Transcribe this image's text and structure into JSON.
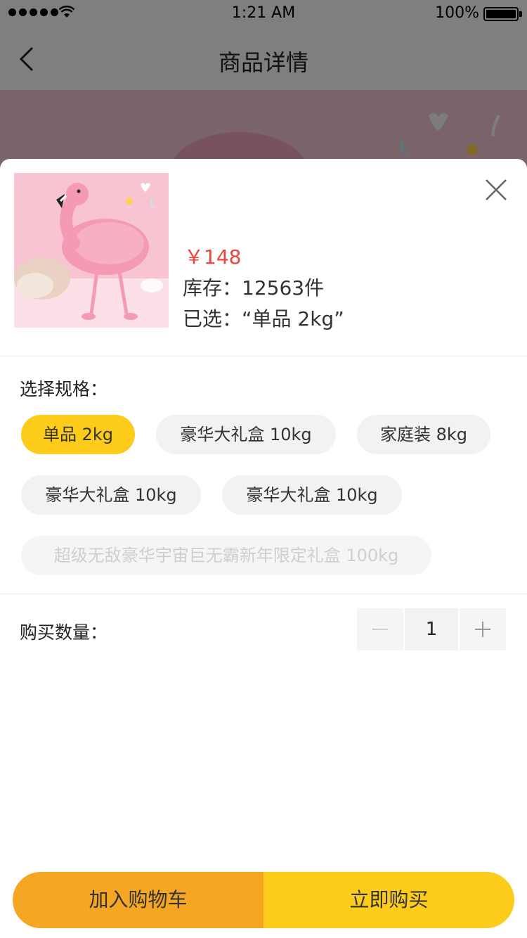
{
  "status_bar": {
    "time": "1:21 AM",
    "battery": "100%"
  },
  "nav": {
    "title": "商品详情"
  },
  "product": {
    "price": "￥148",
    "stock": "库存：12563件",
    "selected": "已选：“单品 2kg”"
  },
  "spec": {
    "label": "选择规格：",
    "options": [
      {
        "label": "单品 2kg",
        "state": "selected"
      },
      {
        "label": "豪华大礼盒 10kg",
        "state": "normal"
      },
      {
        "label": "家庭装 8kg",
        "state": "normal"
      },
      {
        "label": "豪华大礼盒 10kg",
        "state": "normal"
      },
      {
        "label": "豪华大礼盒 10kg",
        "state": "normal"
      },
      {
        "label": "超级无敌豪华宇宙巨无霸新年限定礼盒 100kg",
        "state": "disabled"
      }
    ]
  },
  "quantity": {
    "label": "购买数量：",
    "value": "1"
  },
  "actions": {
    "add_to_cart": "加入购物车",
    "buy_now": "立即购买"
  },
  "colors": {
    "accent_yellow": "#fdcb1a",
    "accent_orange": "#f5a623",
    "price_red": "#f0433a"
  },
  "icons": {
    "back": "chevron-left-icon",
    "close": "close-icon",
    "minus": "minus-icon",
    "plus": "plus-icon",
    "wifi": "wifi-icon",
    "battery": "battery-icon"
  }
}
